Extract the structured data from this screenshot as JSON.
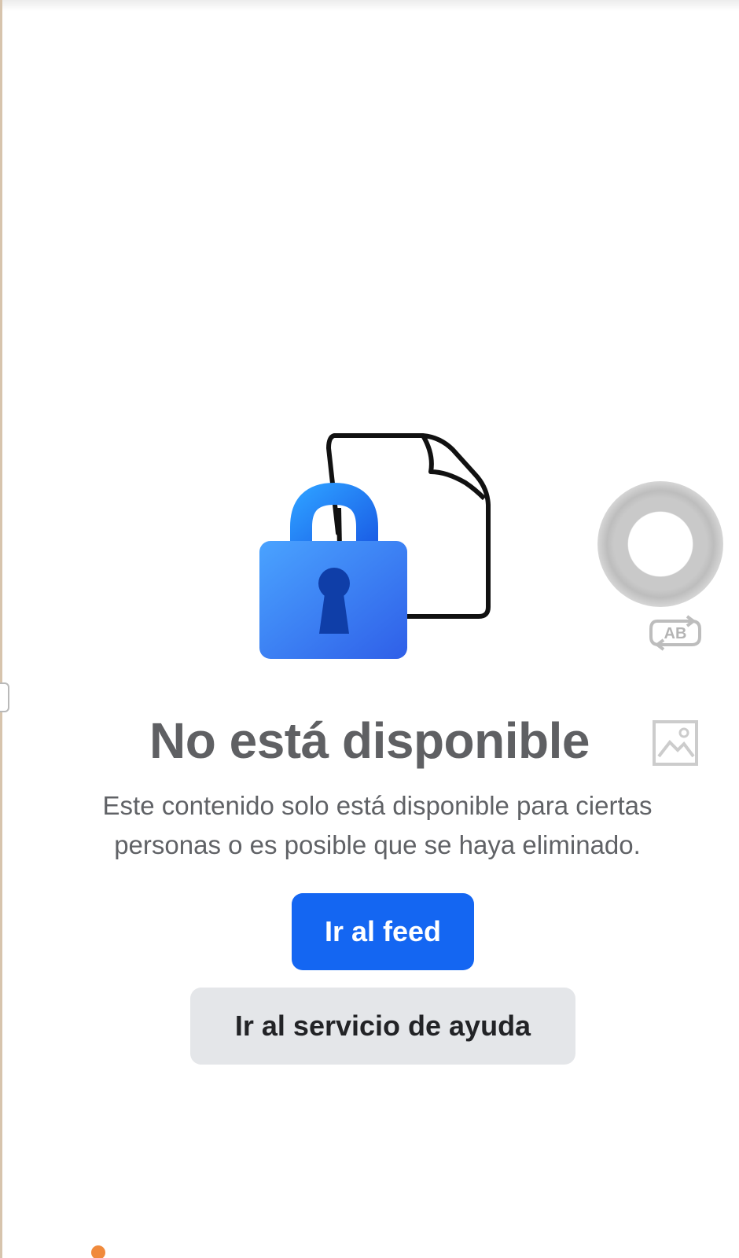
{
  "unavailable": {
    "title": "No está disponible",
    "description": "Este contenido solo está disponible para ciertas personas o es posible que se haya eliminado."
  },
  "actions": {
    "primary_label": "Ir al feed",
    "secondary_label": "Ir al servicio de ayuda"
  },
  "overlay": {
    "ab_label": "AB"
  },
  "colors": {
    "primary_button": "#1466f2",
    "secondary_button": "#e4e6e9",
    "title_text": "#5f6063",
    "lock_blue": "#2d7cf2"
  },
  "icons": {
    "illustration": [
      "document-icon",
      "padlock-icon"
    ],
    "floating": "assistive-touch-icon",
    "ab": "ab-translate-icon",
    "image": "image-icon"
  }
}
